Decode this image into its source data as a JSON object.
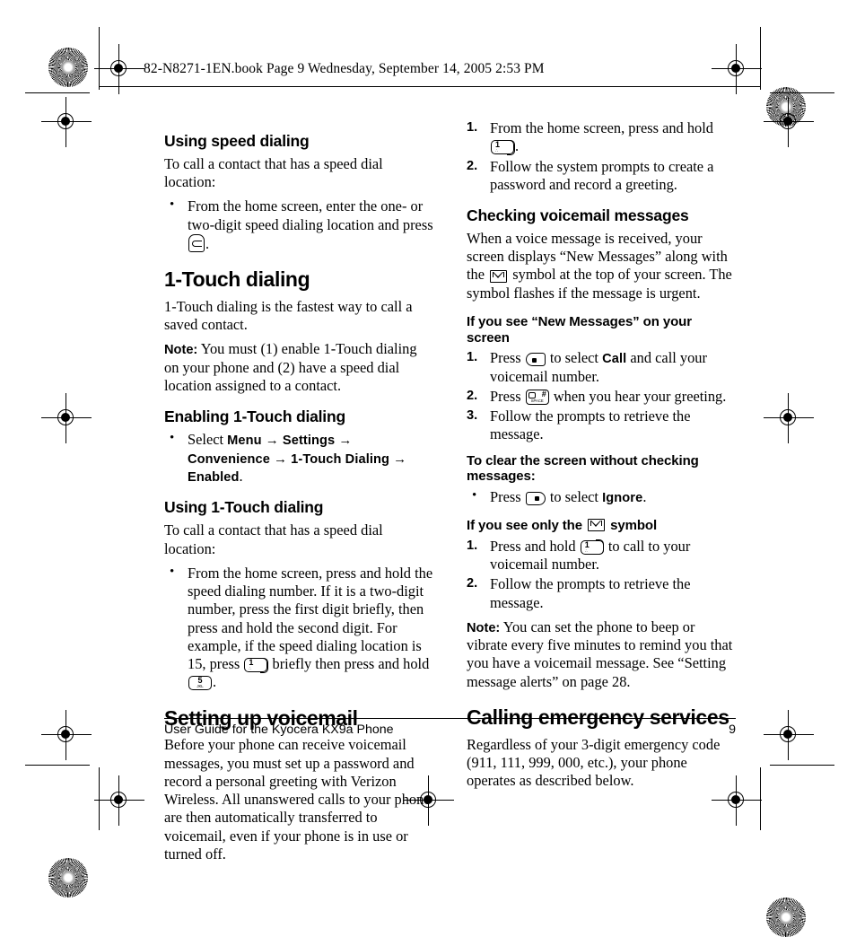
{
  "file_header": "82-N8271-1EN.book  Page 9  Wednesday, September 14, 2005  2:53 PM",
  "footer": {
    "title": "User Guide for the Kyocera KX9a Phone",
    "page_number": "9"
  },
  "left_column": {
    "speed_dialing": {
      "heading": "Using speed dialing",
      "intro": "To call a contact that has a speed dial location:",
      "bullet": "From the home screen, enter the one- or two-digit speed dialing location and press",
      "bullet_end": "."
    },
    "one_touch": {
      "heading": "1-Touch dialing",
      "intro": "1-Touch dialing is the fastest way to call a saved contact.",
      "note_label": "Note:",
      "note_text": "You must (1) enable 1-Touch dialing on your phone and (2) have a speed dial location assigned to a contact."
    },
    "enabling": {
      "heading": "Enabling 1-Touch dialing",
      "bullet_lead": "Select",
      "menu_1": "Menu",
      "menu_2": "Settings",
      "menu_3": "Convenience",
      "menu_4": "1-Touch Dialing",
      "menu_5": "Enabled",
      "arrow": "→",
      "period": "."
    },
    "using_one_touch": {
      "heading": "Using 1-Touch dialing",
      "intro": "To call a contact that has a speed dial location:",
      "bullet_part1": "From the home screen, press and hold the speed dialing number. If it is a two-digit number, press the first digit briefly, then press and hold the second digit. For example, if the speed dialing location is 15, press",
      "bullet_part2": "briefly then press and hold",
      "bullet_part3": "."
    },
    "setting_voicemail": {
      "heading": "Setting up voicemail",
      "paragraph": "Before your phone can receive voicemail messages, you must set up a password and record a personal greeting with Verizon Wireless. All unanswered calls to your phone are then automatically transferred to voicemail, even if your phone is in use or turned off."
    }
  },
  "right_column": {
    "setup_steps": [
      {
        "num": "1.",
        "text_a": "From the home screen, press and hold",
        "text_b": "."
      },
      {
        "num": "2.",
        "text_a": "Follow the system prompts to create a password and record a greeting.",
        "text_b": ""
      }
    ],
    "checking": {
      "heading": "Checking voicemail messages",
      "para_a": "When a voice message is received, your screen displays “New Messages” along with the",
      "para_b": "symbol at the top of your screen. The symbol flashes if the message is urgent."
    },
    "new_messages": {
      "heading": "If you see “New Messages” on your screen",
      "step1_a": "Press",
      "step1_b": "to select",
      "step1_bold": "Call",
      "step1_c": "and call your voicemail number.",
      "step2_a": "Press",
      "step2_b": "when you hear your greeting.",
      "step3": "Follow the prompts to retrieve the message.",
      "n1": "1.",
      "n2": "2.",
      "n3": "3."
    },
    "clear_screen": {
      "heading": "To clear the screen without checking messages:",
      "bullet_a": "Press",
      "bullet_b": "to select",
      "bullet_bold": "Ignore",
      "bullet_c": "."
    },
    "only_symbol": {
      "heading_a": "If you see only the",
      "heading_b": "symbol",
      "step1_a": "Press and hold",
      "step1_b": "to call to your voicemail number.",
      "step2": "Follow the prompts to retrieve the message.",
      "n1": "1.",
      "n2": "2.",
      "note_label": "Note:",
      "note_text": "You can set the phone to beep or vibrate every five minutes to remind you that you have a voicemail message. See “Setting message alerts” on page 28."
    },
    "emergency": {
      "heading": "Calling emergency services",
      "paragraph": "Regardless of your 3-digit emergency code (911, 111, 999, 000, etc.), your phone operates as described below."
    }
  },
  "keys": {
    "one_digit": "1",
    "one_sub": "∴",
    "five_digit": "5",
    "five_sub": "JKL",
    "hash_digit": "#",
    "hash_sub": "SPACE"
  }
}
